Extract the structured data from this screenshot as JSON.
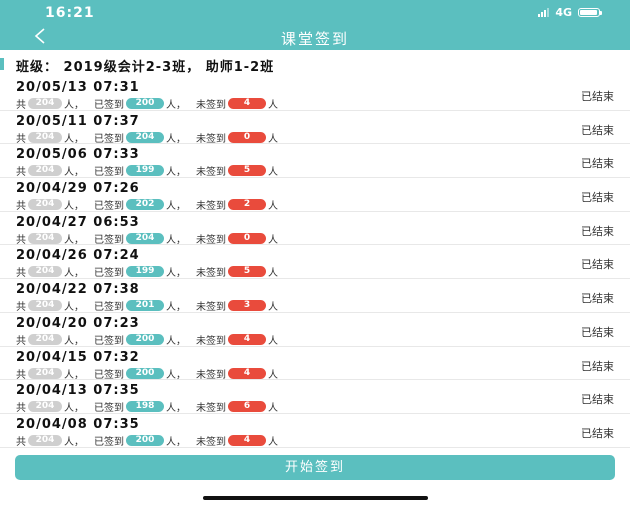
{
  "status_bar": {
    "time": "16:21",
    "network": "4G"
  },
  "header": {
    "title": "课堂签到",
    "back_label": "<"
  },
  "class_info": "班级：  2019级会计2-3班，  助师1-2班",
  "labels": {
    "total_prefix": "共",
    "person": "人，",
    "signed": "已签到",
    "unsigned": "未签到",
    "person_end": "人"
  },
  "sessions": [
    {
      "datetime": "20/05/13 07:31",
      "total": "204",
      "signed": "200",
      "unsigned": "4",
      "status": "已结束"
    },
    {
      "datetime": "20/05/11 07:37",
      "total": "204",
      "signed": "204",
      "unsigned": "0",
      "status": "已结束"
    },
    {
      "datetime": "20/05/06 07:33",
      "total": "204",
      "signed": "199",
      "unsigned": "5",
      "status": "已结束"
    },
    {
      "datetime": "20/04/29 07:26",
      "total": "204",
      "signed": "202",
      "unsigned": "2",
      "status": "已结束"
    },
    {
      "datetime": "20/04/27 06:53",
      "total": "204",
      "signed": "204",
      "unsigned": "0",
      "status": "已结束"
    },
    {
      "datetime": "20/04/26 07:24",
      "total": "204",
      "signed": "199",
      "unsigned": "5",
      "status": "已结束"
    },
    {
      "datetime": "20/04/22 07:38",
      "total": "204",
      "signed": "201",
      "unsigned": "3",
      "status": "已结束"
    },
    {
      "datetime": "20/04/20 07:23",
      "total": "204",
      "signed": "200",
      "unsigned": "4",
      "status": "已结束"
    },
    {
      "datetime": "20/04/15 07:32",
      "total": "204",
      "signed": "200",
      "unsigned": "4",
      "status": "已结束"
    },
    {
      "datetime": "20/04/13 07:35",
      "total": "204",
      "signed": "198",
      "unsigned": "6",
      "status": "已结束"
    },
    {
      "datetime": "20/04/08 07:35",
      "total": "204",
      "signed": "200",
      "unsigned": "4",
      "status": "已结束"
    }
  ],
  "start_button": "开始签到",
  "colors": {
    "accent": "#5bbfbf",
    "unsigned": "#e94b3c",
    "total": "#cfcfcf"
  }
}
